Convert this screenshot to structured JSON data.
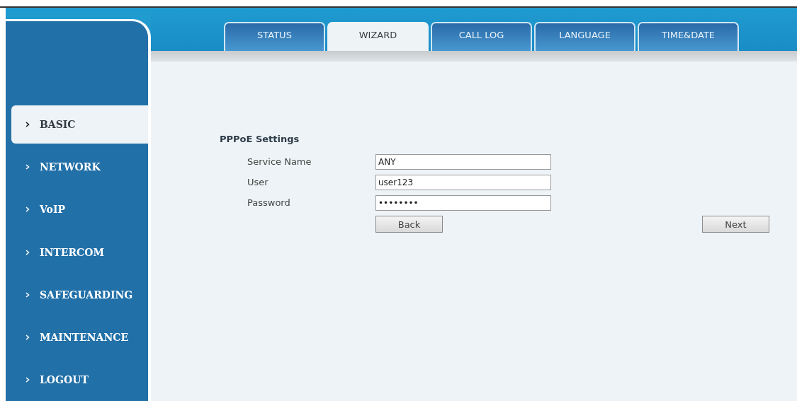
{
  "tabs": [
    {
      "label": "STATUS",
      "selected": false
    },
    {
      "label": "WIZARD",
      "selected": true
    },
    {
      "label": "CALL LOG",
      "selected": false
    },
    {
      "label": "LANGUAGE",
      "selected": false
    },
    {
      "label": "TIME&DATE",
      "selected": false
    }
  ],
  "sidebar": {
    "items": [
      {
        "label": "BASIC",
        "selected": true
      },
      {
        "label": "NETWORK",
        "selected": false
      },
      {
        "label": "VoIP",
        "selected": false
      },
      {
        "label": "INTERCOM",
        "selected": false
      },
      {
        "label": "SAFEGUARDING",
        "selected": false
      },
      {
        "label": "MAINTENANCE",
        "selected": false
      },
      {
        "label": "LOGOUT",
        "selected": false
      }
    ]
  },
  "form": {
    "title": "PPPoE Settings",
    "fields": [
      {
        "label": "Service Name",
        "value": "ANY"
      },
      {
        "label": "User",
        "value": "user123"
      },
      {
        "label": "Password",
        "value": "••••••••"
      }
    ],
    "buttons": [
      {
        "label": "Back"
      },
      {
        "label": "Next"
      }
    ]
  }
}
